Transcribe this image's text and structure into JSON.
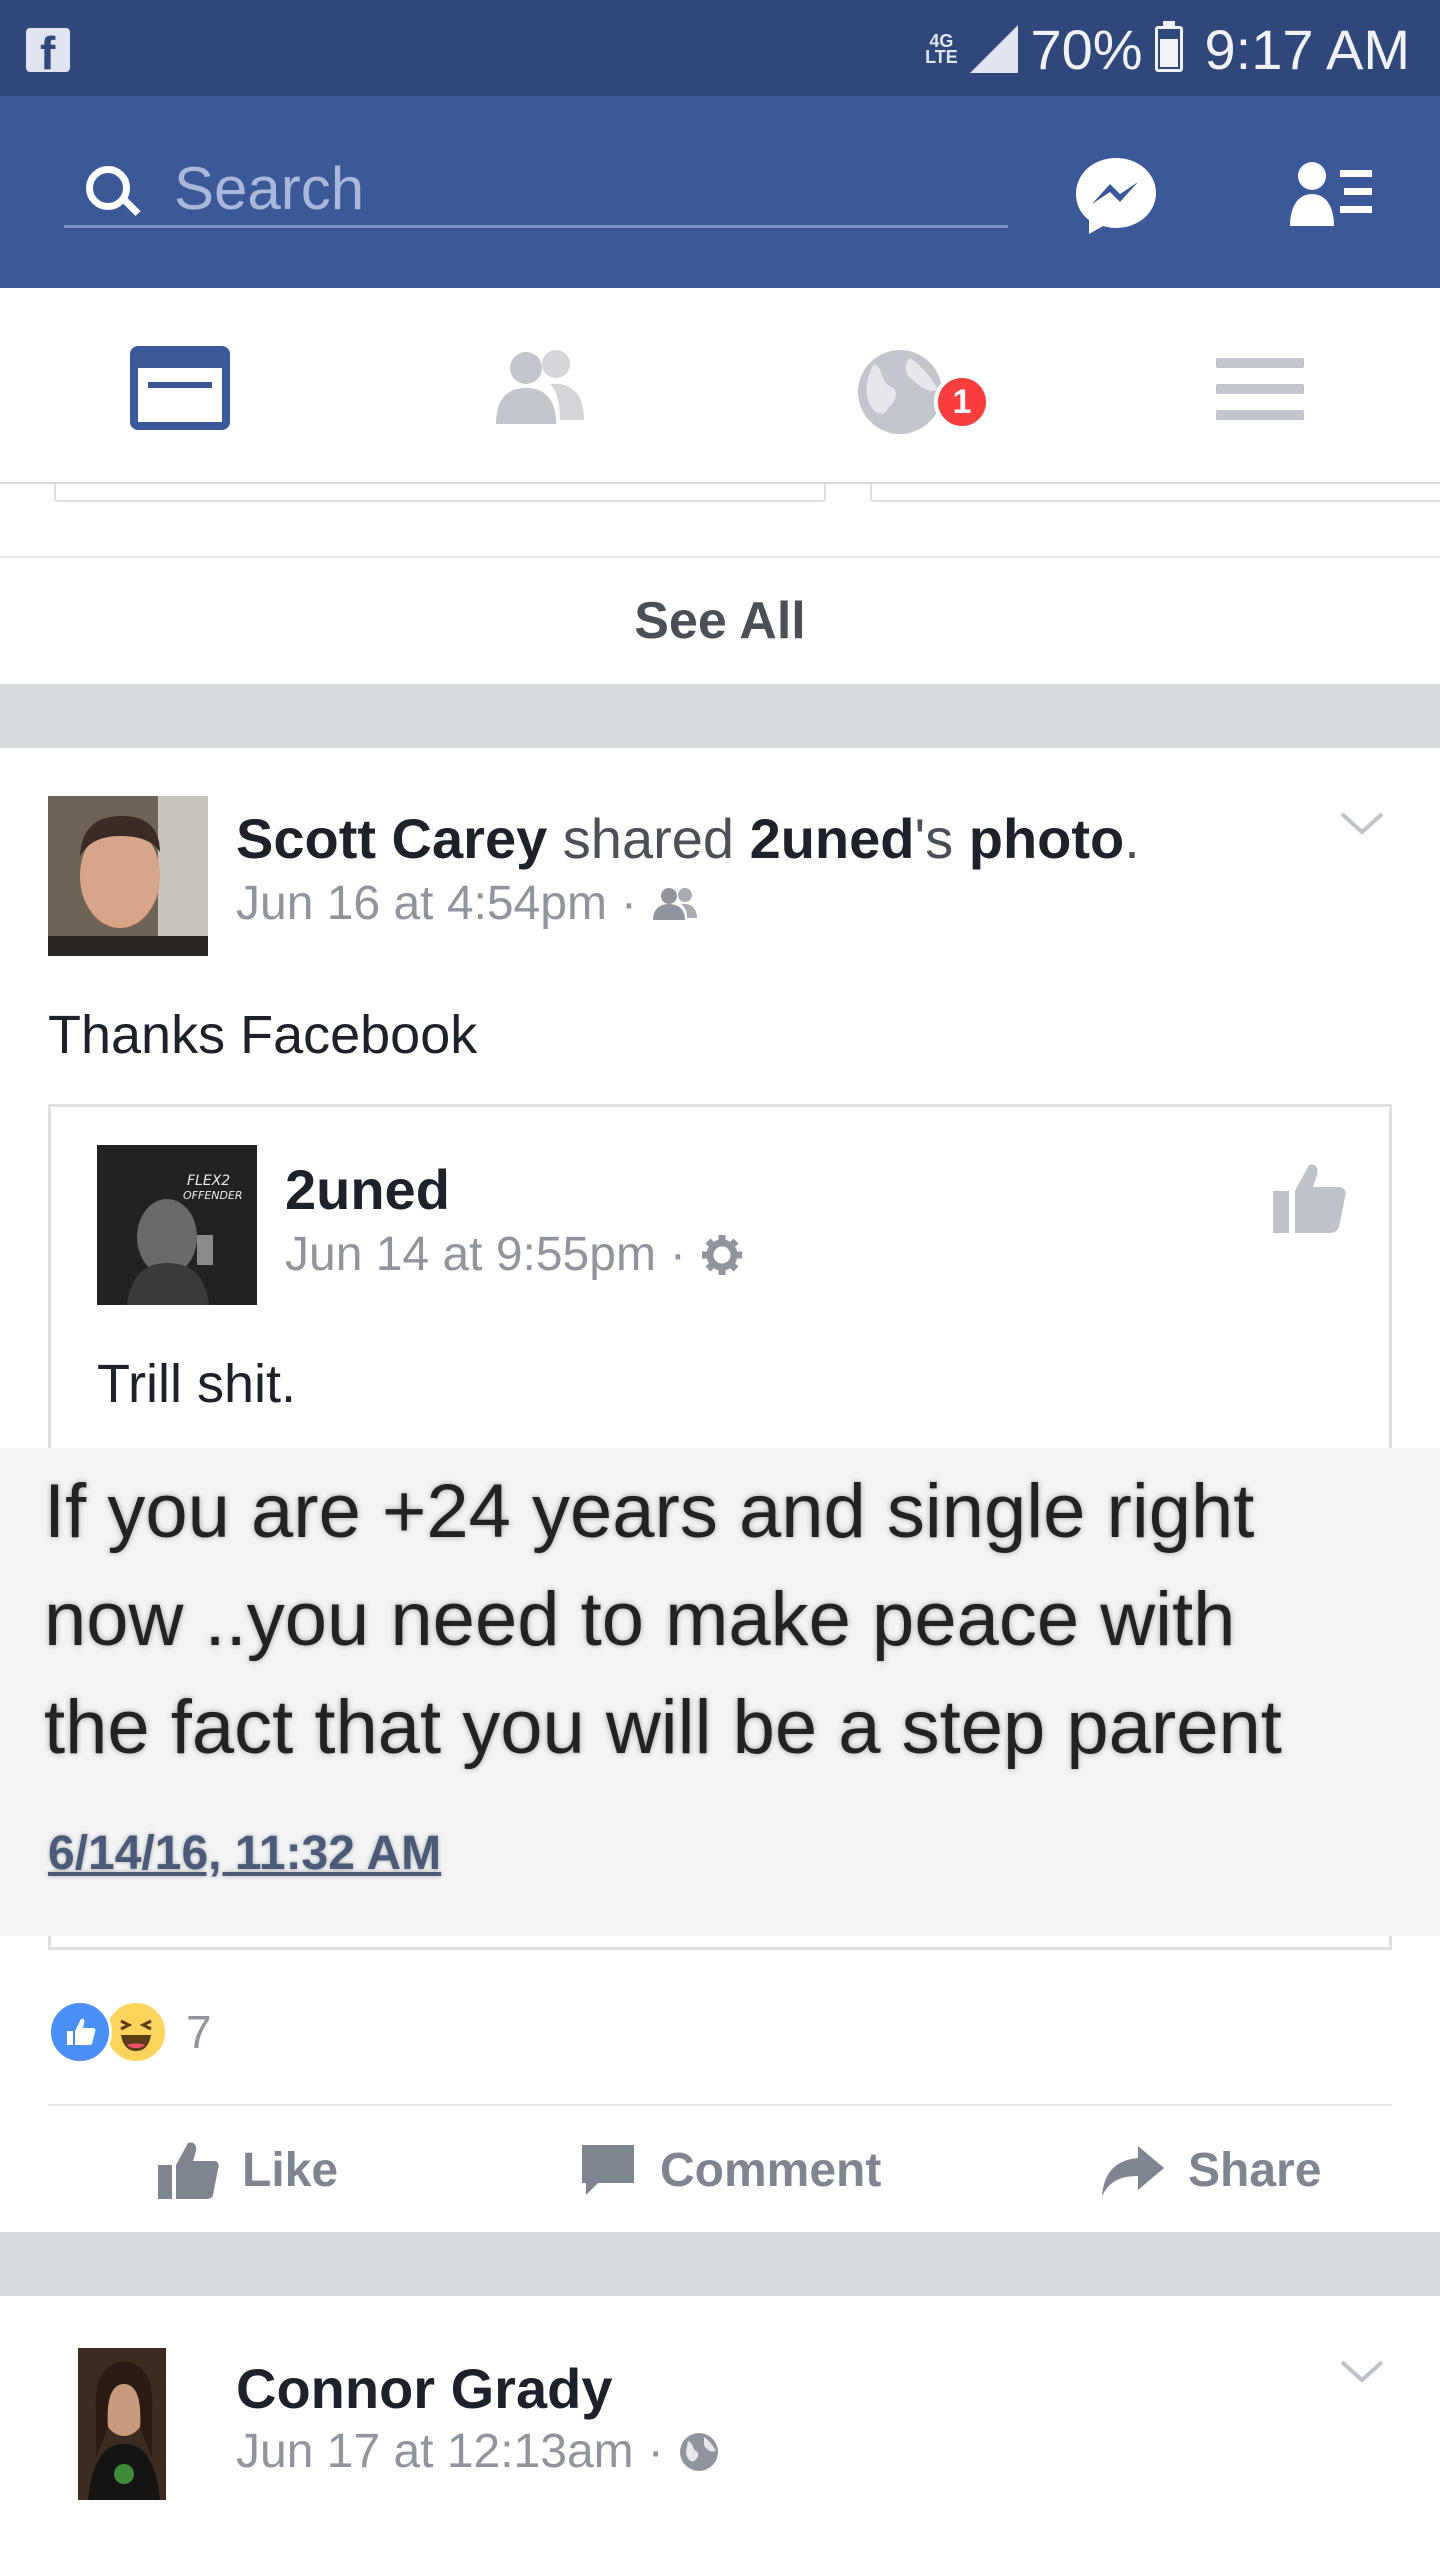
{
  "status_bar": {
    "network_label": "4G LTE",
    "battery_percent": "70%",
    "time": "9:17 AM"
  },
  "search": {
    "placeholder": "Search"
  },
  "tabs": {
    "notifications_badge": "1"
  },
  "see_all_label": "See All",
  "post": {
    "author": "Scott Carey",
    "shared_word": " shared ",
    "shared_owner": "2uned",
    "possessive": "'s ",
    "object": "photo",
    "period": ".",
    "timestamp": "Jun 16 at 4:54pm",
    "dot": "·",
    "text": "Thanks Facebook",
    "shared": {
      "author": "2uned",
      "timestamp": "Jun 14 at 9:55pm",
      "dot": "·",
      "text": "Trill shit.",
      "image": {
        "line1": "If you are +24 years and single right",
        "line2": "now ..you need to make peace with",
        "line3": "the fact that you will be a step parent",
        "date": "6/14/16, 11:32 AM"
      }
    },
    "reaction_count": "7",
    "actions": {
      "like": "Like",
      "comment": "Comment",
      "share": "Share"
    }
  },
  "post2": {
    "author": "Connor Grady",
    "timestamp": "Jun 17 at 12:13am",
    "dot": "·"
  },
  "colors": {
    "status_bar": "#2f477a",
    "header": "#3b5998",
    "active_tab": "#3b5998",
    "badge": "#fa3e3e",
    "like_reaction": "#4a8ff5",
    "haha_reaction": "#fcd35b"
  }
}
